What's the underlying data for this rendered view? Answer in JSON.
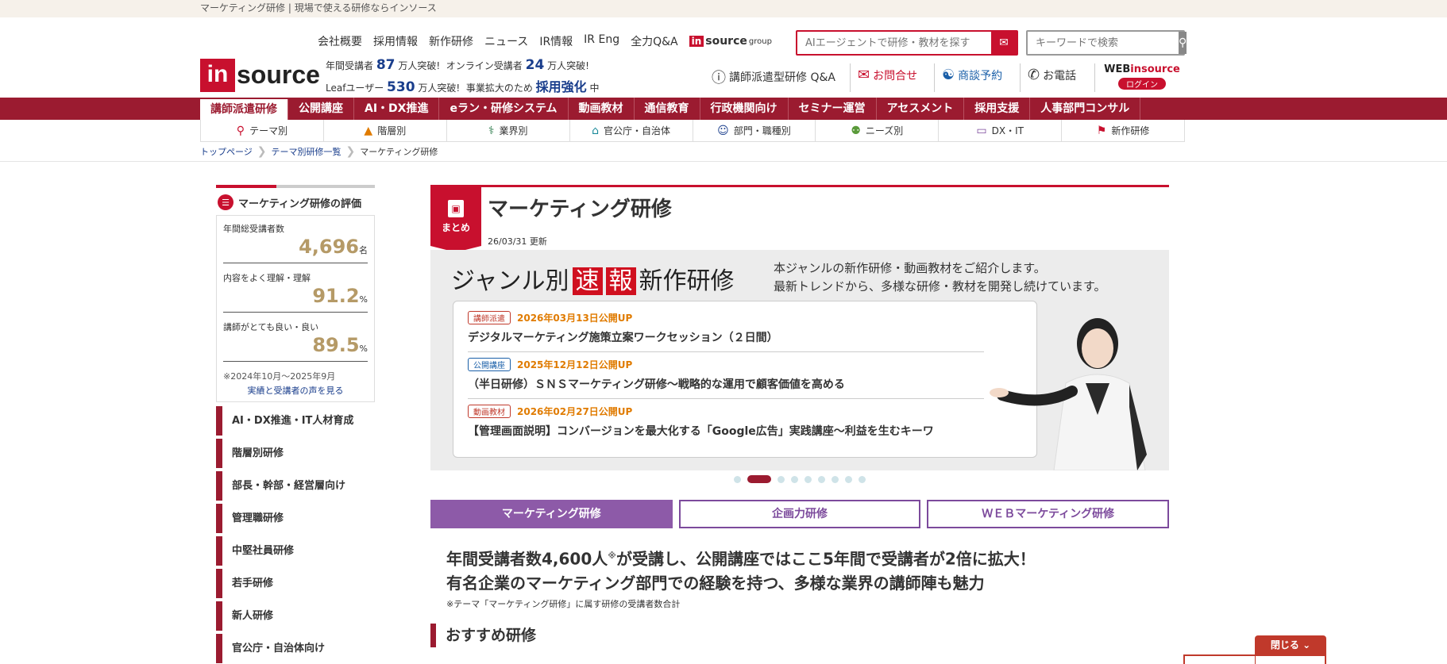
{
  "topbar": {
    "text": "マーケティング研修 | 現場で使える研修ならインソース"
  },
  "header": {
    "logo_text_in": "in",
    "logo_text_source": "source",
    "toplinks": [
      "会社概要",
      "採用情報",
      "新作研修",
      "ニュース",
      "IR情報",
      "IR Eng",
      "全力Q&A"
    ],
    "group_logo": {
      "in": "in",
      "source": "source",
      "group": "group"
    },
    "stats_line1": {
      "a_label": "年間受講者",
      "a_num": "87",
      "a_unit": "万人突破!",
      "b_label": "オンライン受講者",
      "b_num": "24",
      "b_unit": "万人突破!"
    },
    "stats_line2": {
      "a_label": "Leafユーザー",
      "a_num": "530",
      "a_unit": "万人突破!",
      "b_label": "事業拡大のため",
      "b_hl": "採用強化",
      "b_unit": "中"
    },
    "ai_search": {
      "placeholder": "AIエージェントで研修・教材を探す"
    },
    "kw_search": {
      "placeholder": "キーワードで検索"
    },
    "util": {
      "qa": "講師派遣型研修 Q&A",
      "contact": "お問合せ",
      "meeting": "商談予約",
      "phone": "お電話",
      "web_prefix": "WEB",
      "web_suffix": "insource",
      "login": "ログイン"
    }
  },
  "mainnav": [
    "講師派遣研修",
    "公開講座",
    "AI・DX推進",
    "eラン・研修システム",
    "動画教材",
    "通信教育",
    "行政機関向け",
    "セミナー運営",
    "アセスメント",
    "採用支援",
    "人事部門コンサル"
  ],
  "subnav": [
    {
      "label": "テーマ別",
      "icon": "search-icon"
    },
    {
      "label": "階層別",
      "icon": "pyramid-icon"
    },
    {
      "label": "業界別",
      "icon": "signpost-icon"
    },
    {
      "label": "官公庁・自治体",
      "icon": "building-icon"
    },
    {
      "label": "部門・職種別",
      "icon": "person-icon"
    },
    {
      "label": "ニーズ別",
      "icon": "people-icon"
    },
    {
      "label": "DX・IT",
      "icon": "monitor-icon"
    },
    {
      "label": "新作研修",
      "icon": "flag-icon"
    }
  ],
  "breadcrumb": [
    "トップページ",
    "テーマ別研修一覧",
    "マーケティング研修"
  ],
  "rating": {
    "title": "マーケティング研修の評価",
    "rows": [
      {
        "label": "年間総受講者数",
        "value": "4,696",
        "unit": "名"
      },
      {
        "label": "内容をよく理解・理解",
        "value": "91.2",
        "unit": "%"
      },
      {
        "label": "講師がとても良い・良い",
        "value": "89.5",
        "unit": "%"
      }
    ],
    "note": "※2024年10月～2025年9月",
    "more": "実績と受講者の声を見る"
  },
  "sidemenu": [
    "AI・DX推進・IT人材育成",
    "階層別研修",
    "部長・幹部・経営層向け",
    "管理職研修",
    "中堅社員研修",
    "若手研修",
    "新人研修",
    "官公庁・自治体向け"
  ],
  "article": {
    "tag": "まとめ",
    "title": "マーケティング研修",
    "updated": "26/03/31 更新",
    "banner": {
      "title_a": "ジャンル別",
      "title_red1": "速",
      "title_red2": "報",
      "title_b": "新作研修",
      "desc1": "本ジャンルの新作研修・動画教材をご紹介します。",
      "desc2": "最新トレンドから、多様な研修・教材を開発し続けています。",
      "news": [
        {
          "badge": "講師派遣",
          "color": "#c0392b",
          "date": "2026年03月13日公開UP",
          "text": "デジタルマーケティング施策立案ワークセッション（２日間）"
        },
        {
          "badge": "公開講座",
          "color": "#1a5fa8",
          "date": "2025年12月12日公開UP",
          "text": "（半日研修）ＳＮＳマーケティング研修～戦略的な運用で顧客価値を高める"
        },
        {
          "badge": "動画教材",
          "color": "#c0392b",
          "date": "2026年02月27日公開UP",
          "text": "【管理画面説明】コンバージョンを最大化する「Google広告」実践講座～利益を生むキーワ"
        }
      ]
    },
    "tabs": [
      "マーケティング研修",
      "企画力研修",
      "ＷＥＢマーケティング研修"
    ],
    "lead1_a": "年間受講者数4,600人",
    "lead1_sup": "※",
    "lead1_b": "が受講し、公開講座ではここ5年間で受講者が2倍に拡大！",
    "lead2": "有名企業のマーケティング部門での経験を持つ、多様な業界の講師陣も魅力",
    "lead_note": "※テーマ「マーケティング研修」に属す研修の受講者数合計",
    "recommend": "おすすめ研修"
  },
  "close_label": "閉じる",
  "colors": {
    "brand_red": "#c8102e",
    "nav_bg": "#9b1b30",
    "purple": "#8d5aa8",
    "gold": "#b59a67"
  }
}
